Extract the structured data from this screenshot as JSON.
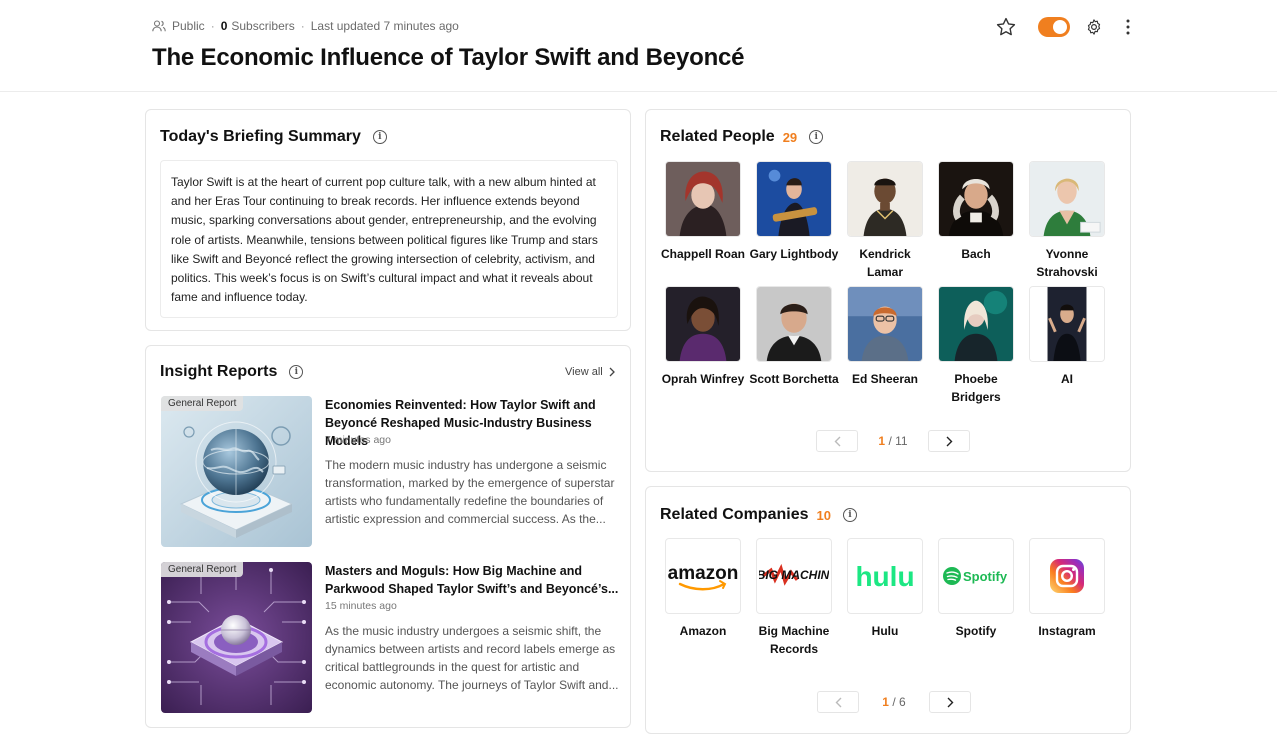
{
  "header": {
    "visibility": "Public",
    "subscriber_count": "0",
    "subscribers_label": "Subscribers",
    "last_updated": "Last updated 7 minutes ago",
    "title": "The Economic Influence of Taylor Swift and Beyoncé",
    "toggle_on": true,
    "accent_color": "#f07f1f"
  },
  "briefing": {
    "title": "Today's Briefing Summary",
    "text": "Taylor Swift is at the heart of current pop culture talk, with a new album hinted at and her Eras Tour continuing to break records. Her influence extends beyond music, sparking conversations about gender, entrepreneurship, and the evolving role of artists. Meanwhile, tensions between political figures like Trump and stars like Swift and Beyoncé reflect the growing intersection of celebrity, activism, and politics. This week’s focus is on Swift’s cultural impact and what it reveals about fame and influence today."
  },
  "insights": {
    "title": "Insight Reports",
    "view_all": "View all",
    "reports": [
      {
        "badge": "General Report",
        "title": "Economies Reinvented: How Taylor Swift and Beyoncé Reshaped Music-Industry Business Models",
        "time": "7 minutes ago",
        "desc": "The modern music industry has undergone a seismic transformation, marked by the emergence of superstar artists who fundamentally redefine the boundaries of artistic expression and commercial success. As the..."
      },
      {
        "badge": "General Report",
        "title": "Masters and Moguls: How Big Machine and Parkwood Shaped Taylor Swift’s and Beyoncé’s...",
        "time": "15 minutes ago",
        "desc": "As the music industry undergoes a seismic shift, the dynamics between artists and record labels emerge as critical battlegrounds in the quest for artistic and economic autonomy. The journeys of Taylor Swift and..."
      }
    ]
  },
  "people": {
    "title": "Related People",
    "count": "29",
    "items": [
      {
        "name": "Chappell Roan"
      },
      {
        "name": "Gary Lightbody"
      },
      {
        "name": "Kendrick Lamar"
      },
      {
        "name": "Bach"
      },
      {
        "name": "Yvonne Strahovski"
      },
      {
        "name": "Oprah Winfrey"
      },
      {
        "name": "Scott Borchetta"
      },
      {
        "name": "Ed Sheeran"
      },
      {
        "name": "Phoebe Bridgers"
      },
      {
        "name": "AI"
      }
    ],
    "page": "1",
    "page_sep": "/",
    "pages": "11"
  },
  "companies": {
    "title": "Related Companies",
    "count": "10",
    "items": [
      {
        "name": "Amazon",
        "logo": "amazon"
      },
      {
        "name": "Big Machine Records",
        "logo": "BIG MACHINE"
      },
      {
        "name": "Hulu",
        "logo": "hulu"
      },
      {
        "name": "Spotify",
        "logo": "Spotify"
      },
      {
        "name": "Instagram",
        "logo": "instagram-icon"
      }
    ],
    "page": "1",
    "page_sep": "/",
    "pages": "6"
  }
}
